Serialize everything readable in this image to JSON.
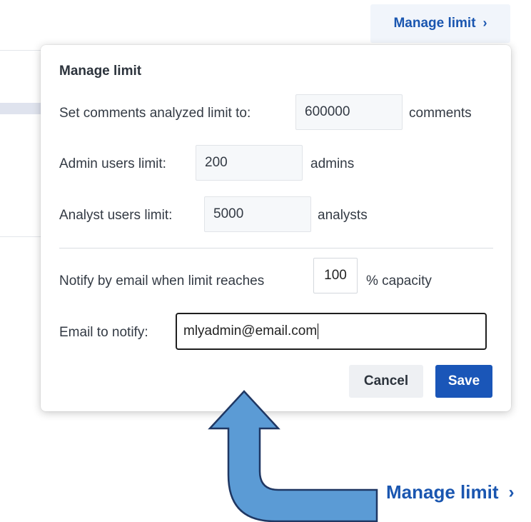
{
  "top_link": {
    "label": "Manage limit",
    "chevron": "›"
  },
  "dialog": {
    "title": "Manage limit",
    "comments_label": "Set comments analyzed limit to:",
    "comments_value": "600000",
    "comments_unit": "comments",
    "admin_label": "Admin users limit:",
    "admin_value": "200",
    "admin_unit": "admins",
    "analyst_label": "Analyst users limit:",
    "analyst_value": "5000",
    "analyst_unit": "analysts",
    "notify_label": "Notify by email when limit reaches",
    "notify_value": "100",
    "notify_unit": "% capacity",
    "email_label": "Email to notify:",
    "email_value": "mlyadmin@email.com",
    "cancel_label": "Cancel",
    "save_label": "Save"
  },
  "bottom_link": {
    "label": "Manage limit",
    "chevron": "›"
  },
  "colors": {
    "link": "#1a56b0",
    "save_button": "#1a56b8",
    "arrow_fill": "#5b9bd5",
    "arrow_stroke": "#1f3763"
  },
  "icons": {
    "link_chevron": "chevron-right-icon",
    "annotation": "u-turn-up-arrow-icon"
  }
}
